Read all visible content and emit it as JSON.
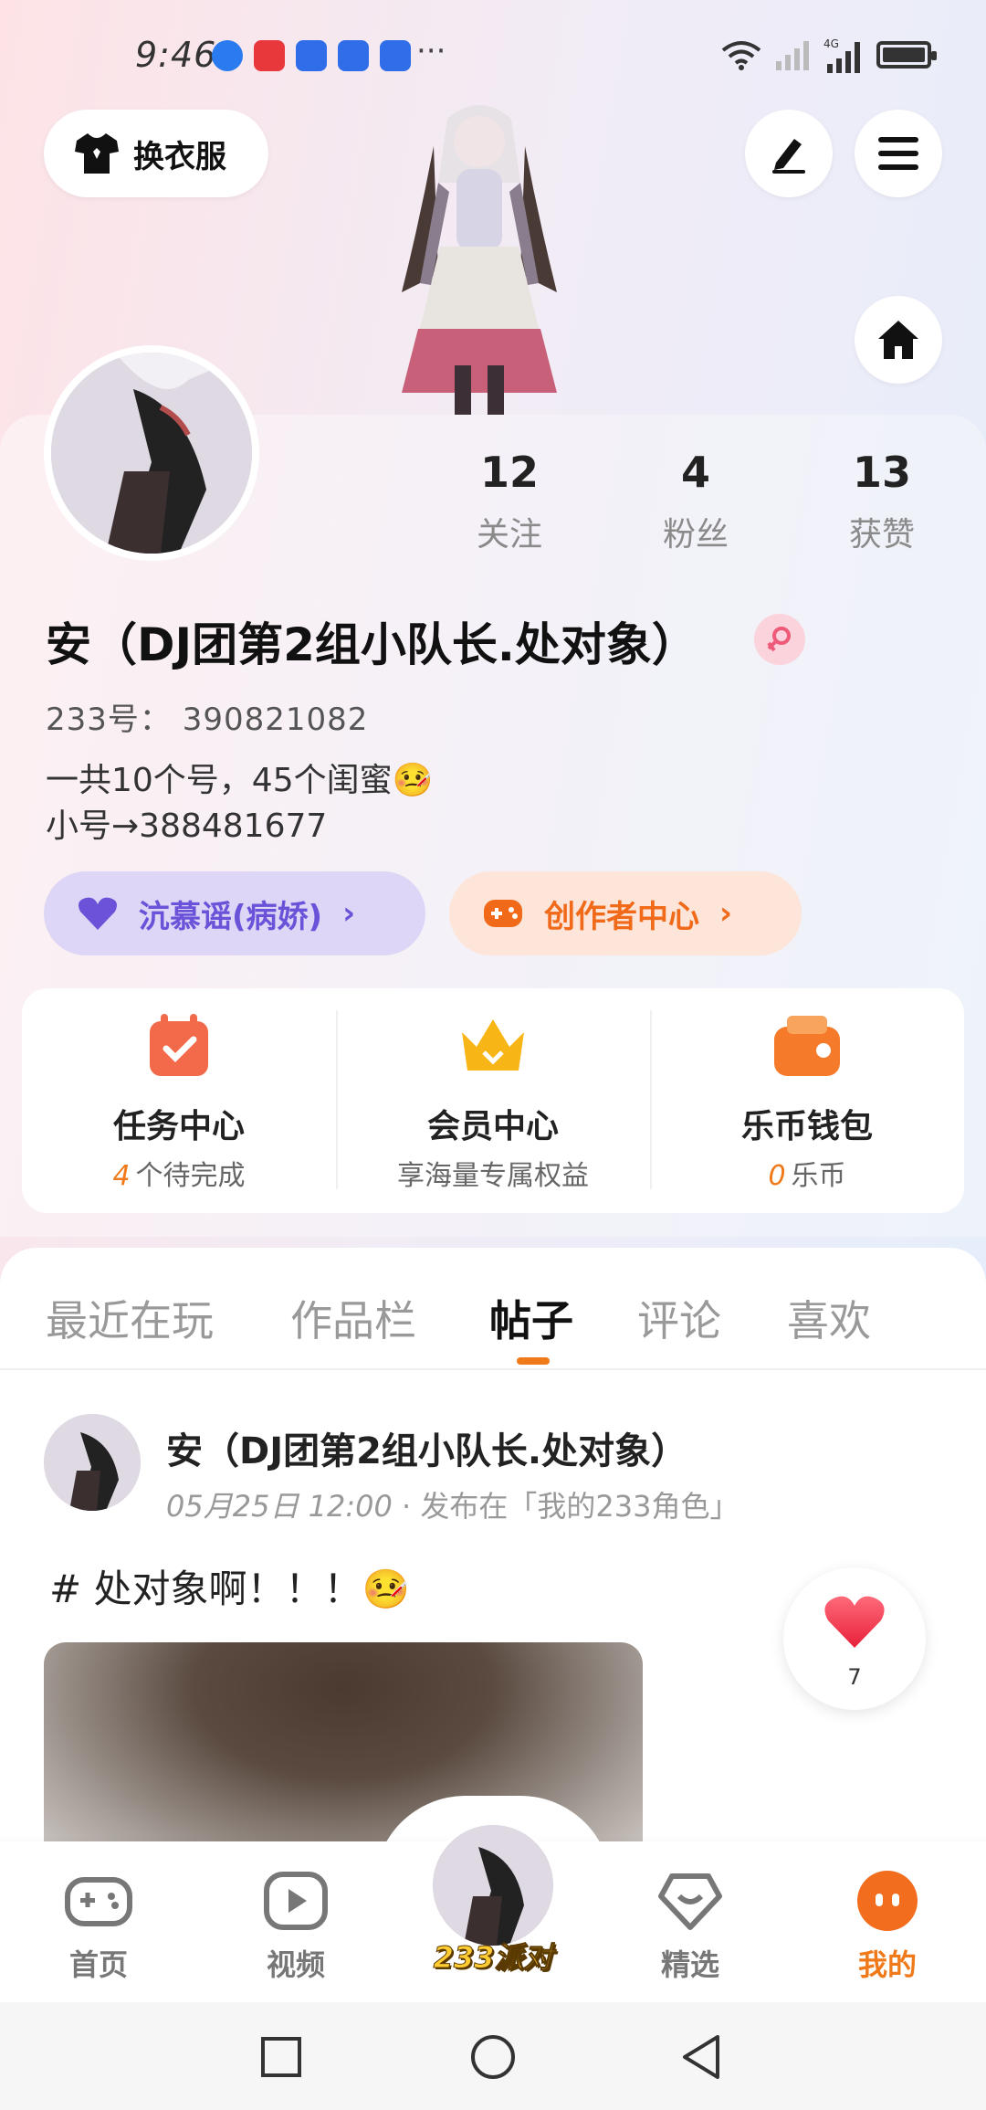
{
  "status_bar": {
    "time": "9:46",
    "more_indicator": "···",
    "network_label": "4G",
    "icons": [
      "browser-icon",
      "huawei-store-icon",
      "baidu-icon",
      "baidu-icon",
      "baidu-icon",
      "wifi-icon",
      "signal-icon",
      "battery-icon"
    ]
  },
  "header": {
    "outfit_button_label": "换衣服",
    "edit_icon": "pencil-icon",
    "menu_icon": "hamburger-icon",
    "home_icon": "home-icon"
  },
  "profile": {
    "stats": [
      {
        "value": "12",
        "label": "关注"
      },
      {
        "value": "4",
        "label": "粉丝"
      },
      {
        "value": "13",
        "label": "获赞"
      }
    ],
    "nickname": "安（DJ团第2组小队长.处对象）",
    "uid": "233号： 390821082",
    "bio_line1": "一共10个号，45个闺蜜🤒",
    "bio_line2": "小号→388481677",
    "pill_left": "沆慕谣(病娇)",
    "pill_right": "创作者中心"
  },
  "services": [
    {
      "title": "任务中心",
      "highlight": "4",
      "subtitle": "个待完成"
    },
    {
      "title": "会员中心",
      "highlight": "",
      "subtitle": "享海量专属权益"
    },
    {
      "title": "乐币钱包",
      "highlight": "0",
      "subtitle": "乐币"
    }
  ],
  "tabs": [
    "最近在玩",
    "作品栏",
    "帖子",
    "评论",
    "喜欢"
  ],
  "active_tab": "帖子",
  "post": {
    "author": "安（DJ团第2组小队长.处对象）",
    "date": "05月25日 12:00",
    "source": "· 发布在「我的233角色」",
    "text": "# 处对象啊！！！🤒",
    "like_count": "7"
  },
  "bottom_nav": [
    {
      "label": "首页",
      "icon": "gamepad-icon"
    },
    {
      "label": "视频",
      "icon": "play-icon"
    },
    {
      "label": "233派对",
      "icon": "avatar-icon"
    },
    {
      "label": "精选",
      "icon": "heart-diamond-icon"
    },
    {
      "label": "我的",
      "icon": "profile-face-icon"
    }
  ],
  "colors": {
    "accent": "#f07a1a",
    "purple": "#6b52d8",
    "like_red": "#f0364a"
  }
}
